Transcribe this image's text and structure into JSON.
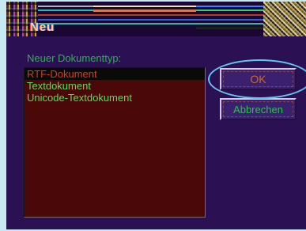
{
  "window": {
    "title": "Neu"
  },
  "dialog": {
    "label": "Neuer Dokumenttyp:",
    "document_types": [
      {
        "label": "RTF-Dokument",
        "selected": true
      },
      {
        "label": "Textdokument",
        "selected": false
      },
      {
        "label": "Unicode-Textdokument",
        "selected": false
      }
    ]
  },
  "buttons": {
    "ok_label": "OK",
    "cancel_label": "Abbrechen"
  },
  "colors": {
    "window_background": "#2c1054",
    "label_text": "#26b44a",
    "list_background": "#4a0808",
    "list_text": "#52e052",
    "selected_text": "#e03818",
    "focus_ring": "#5fc7ef"
  }
}
